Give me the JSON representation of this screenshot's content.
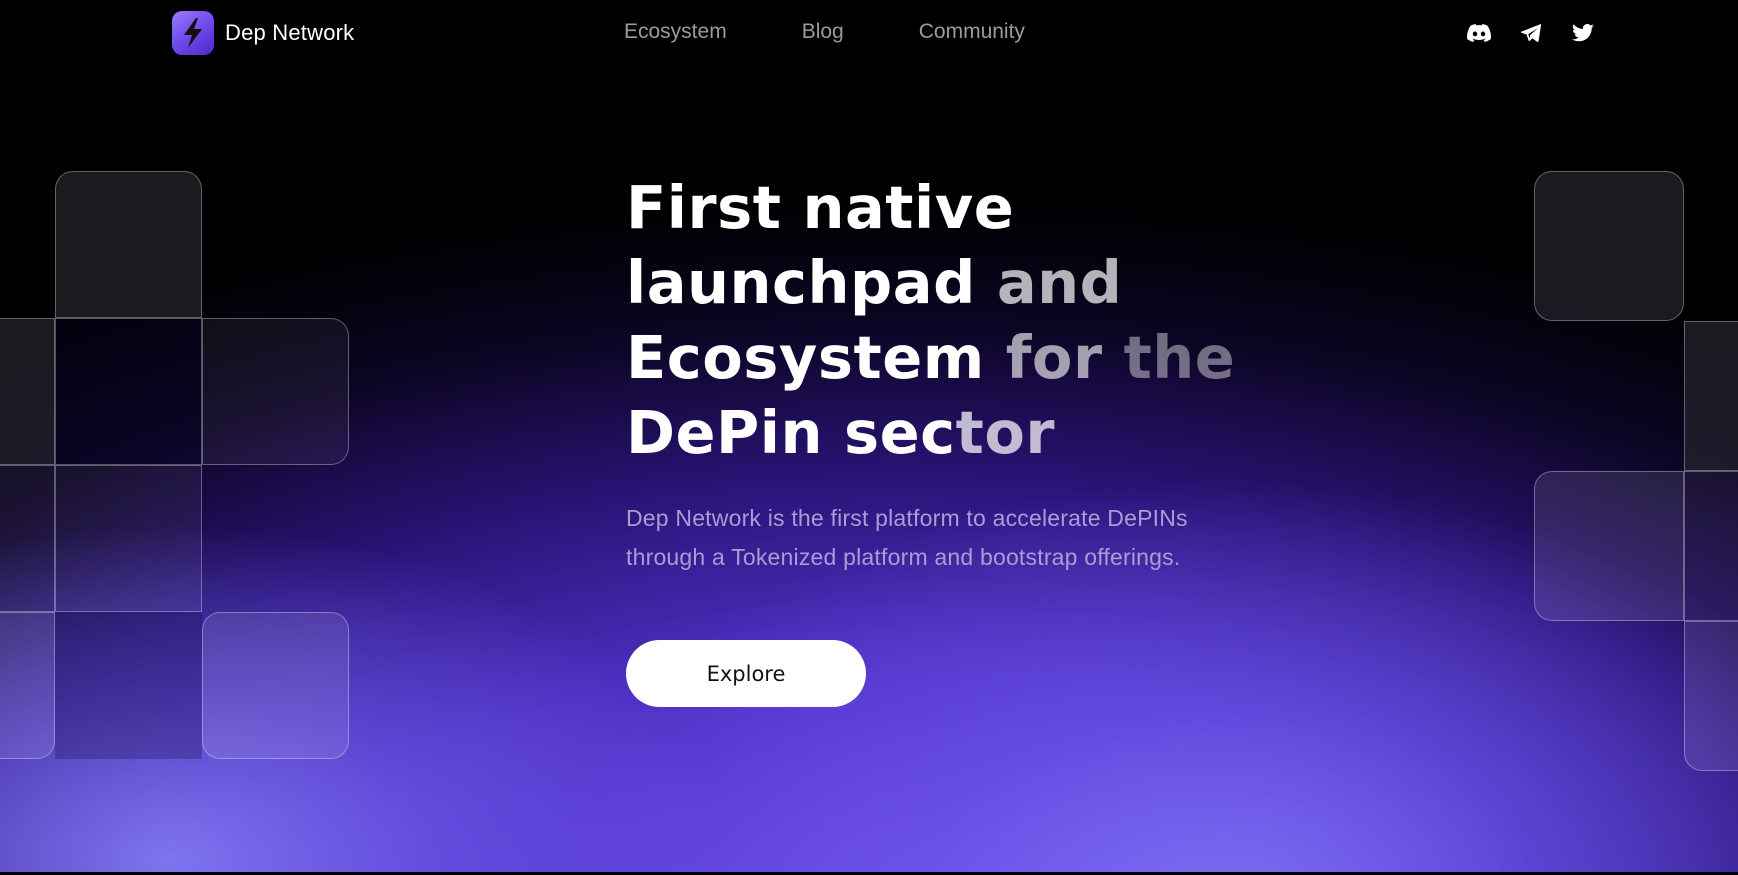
{
  "brand": {
    "name": "Dep Network",
    "logo_icon": "lightning-bolt-icon"
  },
  "nav": {
    "links": [
      {
        "label": "Ecosystem"
      },
      {
        "label": "Blog"
      },
      {
        "label": "Community"
      }
    ],
    "socials": [
      {
        "icon": "discord-icon"
      },
      {
        "icon": "telegram-icon"
      },
      {
        "icon": "twitter-icon"
      }
    ]
  },
  "hero": {
    "headline": {
      "line1": "First native",
      "line2_a": "launchpad",
      "line2_b": " and",
      "line3_a": "Ecosystem",
      "line3_b": " for ",
      "line3_c": "the",
      "line4_a": "DePin sec",
      "line4_b": "tor"
    },
    "subtitle": "Dep Network is the first platform to accelerate DePINs through a Tokenized platform and bootstrap offerings.",
    "cta_label": "Explore"
  },
  "colors": {
    "accent_purple": "#6a47e6",
    "background": "#000000",
    "text_primary": "#ffffff",
    "text_muted": "#9a9aa3",
    "subtitle": "#a79ed6"
  }
}
